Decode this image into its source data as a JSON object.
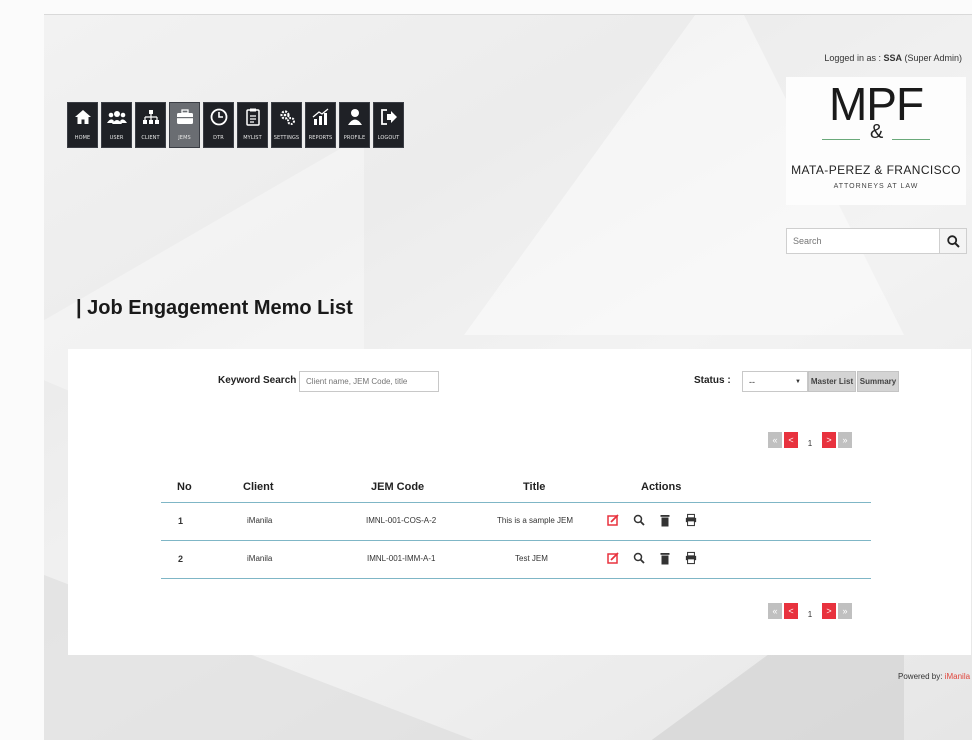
{
  "nav": {
    "items": [
      {
        "label": "HOME",
        "icon": "home-icon"
      },
      {
        "label": "USER",
        "icon": "users-icon"
      },
      {
        "label": "CLIENT",
        "icon": "org-chart-icon"
      },
      {
        "label": "JEMS",
        "icon": "briefcase-icon",
        "active": true
      },
      {
        "label": "DTR",
        "icon": "clock-icon"
      },
      {
        "label": "MYLIST",
        "icon": "clipboard-icon"
      },
      {
        "label": "SETTINGS",
        "icon": "gears-icon"
      },
      {
        "label": "REPORTS",
        "icon": "bar-chart-icon"
      },
      {
        "label": "PROFILE",
        "icon": "person-icon"
      },
      {
        "label": "LOGOUT",
        "icon": "logout-icon"
      }
    ]
  },
  "header": {
    "logged_prefix": "Logged in as : ",
    "user": "SSA",
    "role": " (Super Admin)"
  },
  "logo": {
    "mark": "MPF",
    "amp": "&",
    "name": "MATA-PEREZ & FRANCISCO",
    "sub": "ATTORNEYS AT LAW"
  },
  "search": {
    "placeholder": "Search"
  },
  "page": {
    "title": "| Job Engagement Memo List"
  },
  "filters": {
    "keyword_label": "Keyword Search :",
    "keyword_placeholder": "Client name, JEM Code, title",
    "status_label": "Status :",
    "status_value": "--",
    "master_list_label": "Master List",
    "summary_label": "Summary"
  },
  "pagination": {
    "first": "«",
    "prev": "<",
    "current": "1",
    "next": ">",
    "last": "»"
  },
  "table": {
    "headers": {
      "no": "No",
      "client": "Client",
      "jem_code": "JEM Code",
      "title": "Title",
      "actions": "Actions"
    },
    "rows": [
      {
        "no": "1",
        "client": "iManila",
        "jem_code": "IMNL-001-COS-A-2",
        "title": "This is a sample JEM"
      },
      {
        "no": "2",
        "client": "iManila",
        "jem_code": "IMNL-001-IMM-A-1",
        "title": "Test JEM"
      }
    ]
  },
  "footer": {
    "powered_prefix": "Powered by: ",
    "brand": "iManila"
  },
  "colors": {
    "accent_red": "#e8323e",
    "nav_dark": "#1f2126",
    "row_border": "#7fb6c6"
  }
}
